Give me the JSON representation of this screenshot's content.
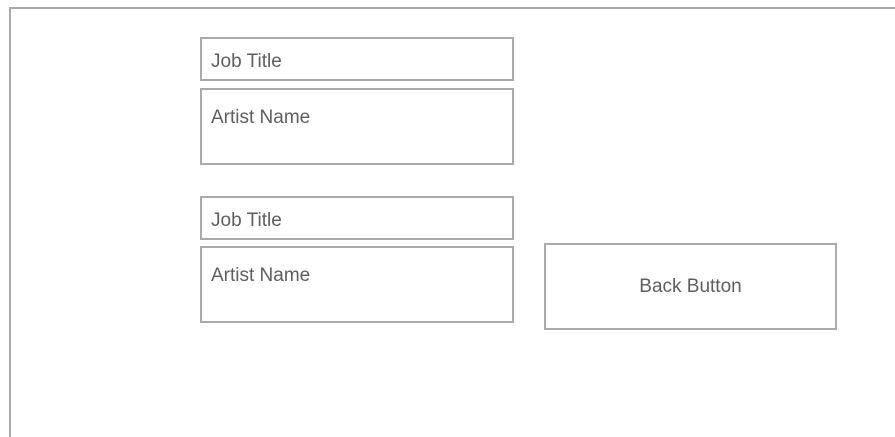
{
  "entries": [
    {
      "job_title": "Job Title",
      "artist_name": "Artist Name"
    },
    {
      "job_title": "Job Title",
      "artist_name": "Artist Name"
    }
  ],
  "back_button": {
    "label": "Back Button"
  },
  "colors": {
    "border": "#aaaaaa",
    "text": "#5e5e5e",
    "background": "#ffffff"
  }
}
